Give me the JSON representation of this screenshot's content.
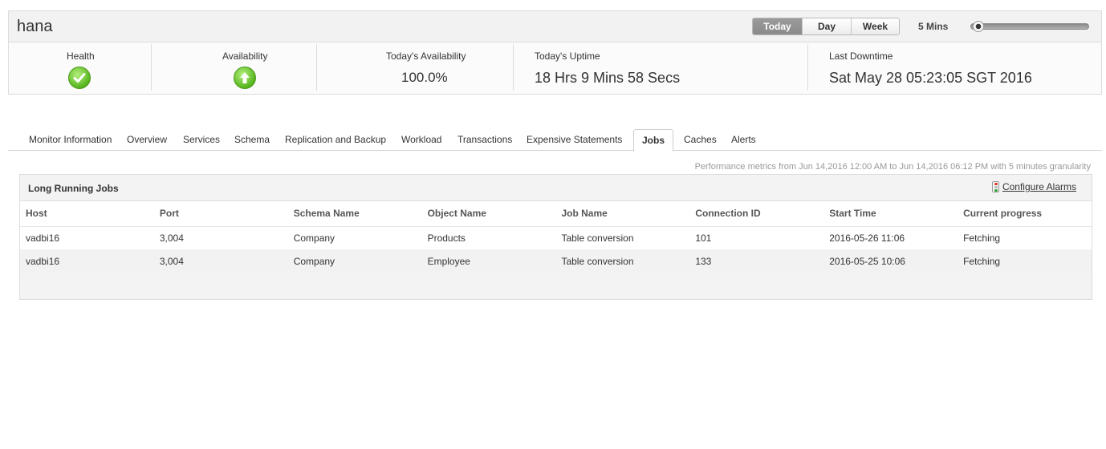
{
  "header": {
    "monitor_name": "hana",
    "period_buttons": [
      "Today",
      "Day",
      "Week"
    ],
    "active_period": "Today",
    "interval_label": "5 Mins",
    "slider_level": 0.0
  },
  "metrics": {
    "health": {
      "label": "Health",
      "status": "check-ok"
    },
    "availability": {
      "label": "Availability",
      "status": "up-arrow"
    },
    "todays_availability": {
      "label": "Today's Availability",
      "value": "100.0%"
    },
    "todays_uptime": {
      "label": "Today's Uptime",
      "value": "18 Hrs 9 Mins 58 Secs"
    },
    "last_downtime": {
      "label": "Last Downtime",
      "value": "Sat May 28 05:23:05 SGT 2016"
    }
  },
  "tabs": [
    "Monitor Information",
    "Overview",
    "Services",
    "Schema",
    "Replication and Backup",
    "Workload",
    "Transactions",
    "Expensive Statements",
    "Jobs",
    "Caches",
    "Alerts"
  ],
  "active_tab": "Jobs",
  "perf_note": "Performance metrics from Jun 14,2016 12:00 AM to Jun 14,2016 06:12 PM with 5 minutes granularity",
  "panel": {
    "title": "Long Running Jobs",
    "configure_label": "Configure Alarms",
    "columns": [
      "Host",
      "Port",
      "Schema Name",
      "Object Name",
      "Job Name",
      "Connection ID",
      "Start Time",
      "Current progress"
    ],
    "rows": [
      [
        "vadbi16",
        "3,004",
        "Company",
        "Products",
        "Table conversion",
        "101",
        "2016-05-26 11:06",
        "Fetching"
      ],
      [
        "vadbi16",
        "3,004",
        "Company",
        "Employee",
        "Table conversion",
        "133",
        "2016-05-25 10:06",
        "Fetching"
      ]
    ]
  },
  "colors": {
    "ok_green": "#56b51e",
    "active_period_bg": "#8f8f8f",
    "note_gray": "#999999"
  }
}
